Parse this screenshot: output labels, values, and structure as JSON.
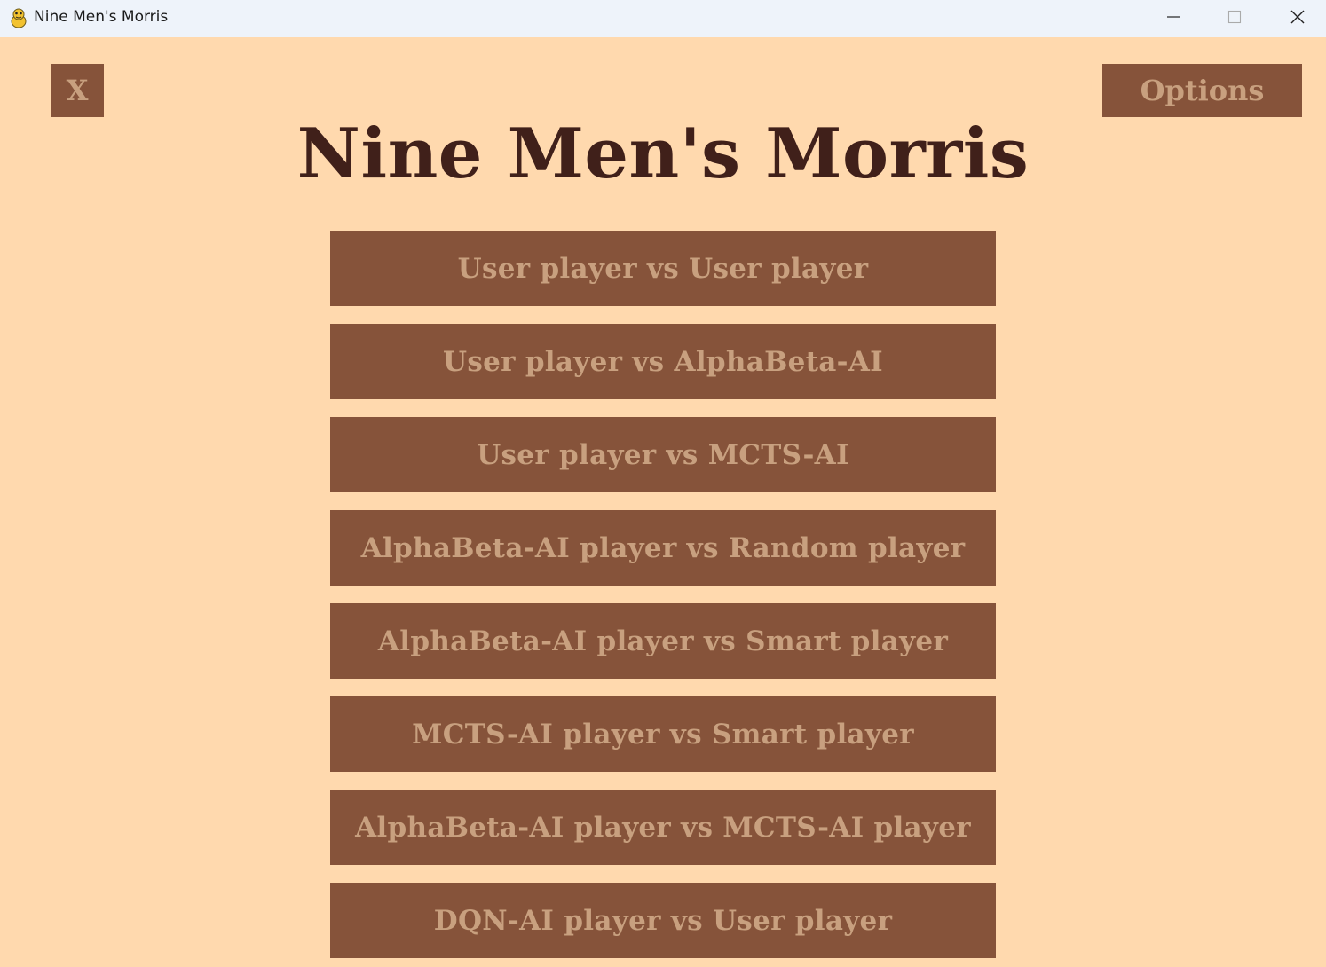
{
  "window": {
    "title": "Nine Men's Morris",
    "icon": "python-snake-icon",
    "controls": [
      "minimize",
      "maximize",
      "close"
    ]
  },
  "game": {
    "close_label": "X",
    "options_label": "Options",
    "title": "Nine Men's Morris",
    "menu": [
      "User player vs User player",
      "User player vs AlphaBeta-AI",
      "User player vs MCTS-AI",
      "AlphaBeta-AI player vs Random player",
      "AlphaBeta-AI player vs Smart player",
      "MCTS-AI player vs Smart player",
      "AlphaBeta-AI player vs MCTS-AI player",
      "DQN-AI player vs User player"
    ]
  },
  "colors": {
    "background": "#ffd9ae",
    "button": "#86533a",
    "button_text": "#c8a07f",
    "title_text": "#40201a",
    "titlebar": "#eef3fa"
  }
}
